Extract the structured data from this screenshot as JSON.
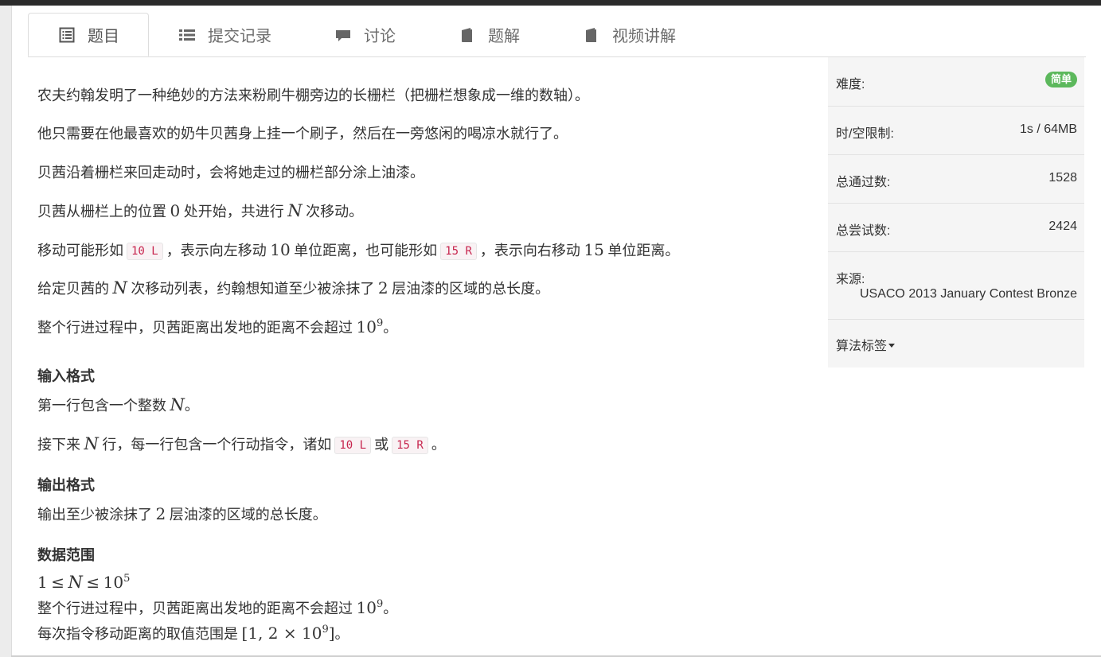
{
  "tabs": [
    {
      "label": "题目",
      "icon": "list-alt-icon",
      "active": true
    },
    {
      "label": "提交记录",
      "icon": "list-icon",
      "active": false
    },
    {
      "label": "讨论",
      "icon": "comment-icon",
      "active": false
    },
    {
      "label": "题解",
      "icon": "book-icon",
      "active": false
    },
    {
      "label": "视频讲解",
      "icon": "book-icon",
      "active": false
    }
  ],
  "problem": {
    "p1": "农夫约翰发明了一种绝妙的方法来粉刷牛棚旁边的长栅栏（把栅栏想象成一维的数轴）。",
    "p2": "他只需要在他最喜欢的奶牛贝茜身上挂一个刷子，然后在一旁悠闲的喝凉水就行了。",
    "p3": "贝茜沿着栅栏来回走动时，会将她走过的栅栏部分涂上油漆。",
    "p4": {
      "a": "贝茜从栅栏上的位置",
      "zero": "0",
      "b": "处开始，共进行",
      "n": "N",
      "c": "次移动。"
    },
    "p5": {
      "a": "移动可能形如",
      "code1": "10 L",
      "b": "，表示向左移动",
      "ten": "10",
      "c": "单位距离，也可能形如",
      "code2": "15 R",
      "d": "，表示向右移动",
      "fifteen": "15",
      "e": "单位距离。"
    },
    "p6": {
      "a": "给定贝茜的",
      "n": "N",
      "b": "次移动列表，约翰想知道至少被涂抹了",
      "two": "2",
      "c": "层油漆的区域的总长度。"
    },
    "p7": {
      "a": "整个行进过程中，贝茜距离出发地的距离不会超过",
      "base": "10",
      "exp": "9",
      "b": "。"
    }
  },
  "input_format": {
    "heading": "输入格式",
    "l1": {
      "a": "第一行包含一个整数",
      "n": "N",
      "b": "。"
    },
    "l2": {
      "a": "接下来",
      "n": "N",
      "b": "行，每一行包含一个行动指令，诸如",
      "code1": "10 L",
      "c": "或",
      "code2": "15 R",
      "d": "。"
    }
  },
  "output_format": {
    "heading": "输出格式",
    "l1": {
      "a": "输出至少被涂抹了",
      "two": "2",
      "b": "层油漆的区域的总长度。"
    }
  },
  "data_range": {
    "heading": "数据范围",
    "l1": {
      "one": "1",
      "le1": "≤",
      "n": "N",
      "le2": "≤",
      "base": "10",
      "exp": "5"
    },
    "l2": {
      "a": "整个行进过程中，贝茜距离出发地的距离不会超过",
      "base": "10",
      "exp": "9",
      "b": "。"
    },
    "l3": {
      "a": "每次指令移动距离的取值范围是",
      "lb": "[",
      "one": "1",
      "comma": ",",
      "two": "2",
      "times": "×",
      "base": "10",
      "exp": "9",
      "rb": "]",
      "b": "。"
    }
  },
  "sidebar": {
    "difficulty_label": "难度:",
    "difficulty_value": "简单",
    "difficulty_color": "#5cb85c",
    "limit_label": "时/空限制:",
    "limit_value": "1s / 64MB",
    "passed_label": "总通过数:",
    "passed_value": "1528",
    "tried_label": "总尝试数:",
    "tried_value": "2424",
    "source_label": "来源:",
    "source_value": "USACO 2013 January Contest Bronze",
    "tags_label": "算法标签"
  }
}
